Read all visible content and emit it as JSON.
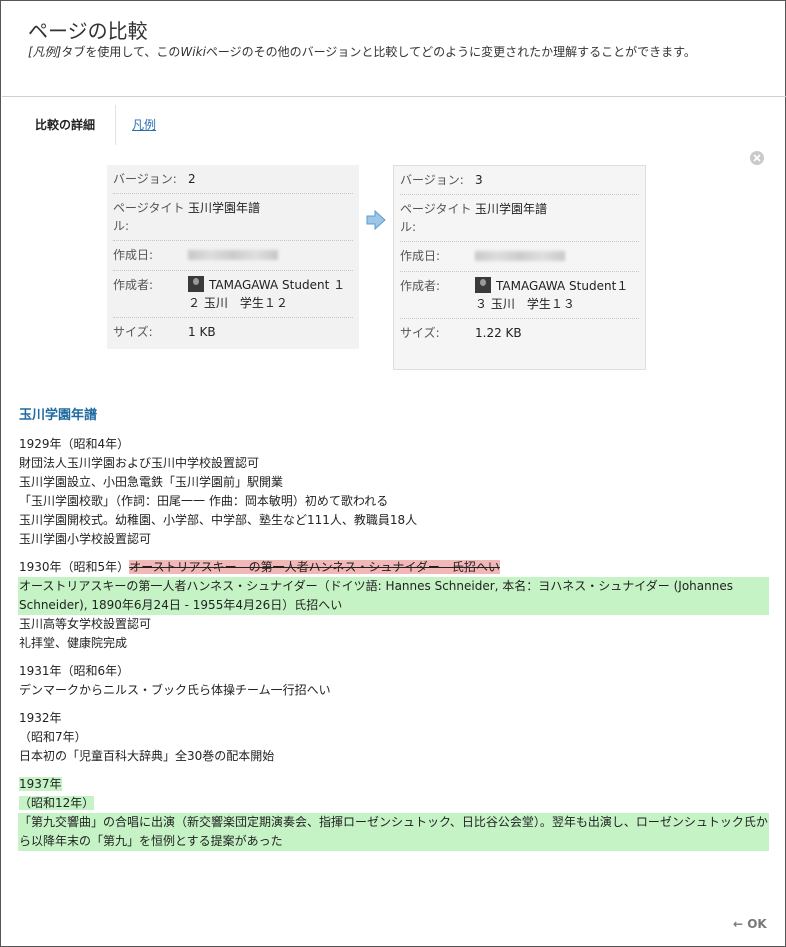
{
  "dialog": {
    "title": "ページの比較",
    "subtitle_prefix": "[凡例]",
    "subtitle_mid": "タブを使用して、この",
    "subtitle_wiki": "Wiki",
    "subtitle_suffix": "ページのその他のバージョンと比較してどのように変更されたか理解することができます。"
  },
  "tabs": {
    "active": "比較の詳細",
    "legend": "凡例"
  },
  "labels": {
    "version": "バージョン:",
    "page_title": "ページタイトル:",
    "created": "作成日:",
    "author": "作成者:",
    "size": "サイズ:"
  },
  "left_version": {
    "version": "2",
    "page_title": "玉川学園年譜",
    "author": "TAMAGAWA Student １２ 玉川　学生１２",
    "size": "1 KB"
  },
  "right_version": {
    "version": "3",
    "page_title": "玉川学園年譜",
    "author": "TAMAGAWA Student１３ 玉川　学生１３",
    "size": "1.22 KB"
  },
  "doc": {
    "title": "玉川学園年譜",
    "b1": [
      "1929年（昭和4年）",
      "財団法人玉川学園および玉川中学校設置認可",
      "玉川学園設立、小田急電鉄「玉川学園前」駅開業",
      "「玉川学園校歌」（作詞：田尾一一 作曲：岡本敏明）初めて歌われる",
      "玉川学園開校式。幼稚園、小学部、中学部、塾生など111人、教職員18人",
      "玉川学園小学校設置認可"
    ],
    "b2_head": "1930年（昭和5年）",
    "b2_deleted": "オーストリアスキー　の第一人者ハンネス・シュナイダー　氏招へい",
    "b2_added": "オーストリアスキーの第一人者ハンネス・シュナイダー（ドイツ語: Hannes Schneider, 本名：ヨハネス・シュナイダー (Johannes Schneider), 1890年6月24日 - 1955年4月26日）氏招へい",
    "b2_rest": [
      "玉川高等女学校設置認可",
      "礼拝堂、健康院完成"
    ],
    "b3": [
      "1931年（昭和6年）",
      "デンマークからニルス・ブック氏ら体操チーム一行招へい"
    ],
    "b4": [
      "1932年",
      "（昭和7年）",
      "日本初の「児童百科大辞典」全30巻の配本開始"
    ],
    "b5": [
      "1937年",
      "（昭和12年）",
      "「第九交響曲」の合唱に出演（新交響楽団定期演奏会、指揮ローゼンシュトック、日比谷公会堂）。翌年も出演し、ローゼンシュトック氏から以降年末の「第九」を恒例とする提案があった"
    ]
  },
  "footer": {
    "ok": "OK"
  }
}
